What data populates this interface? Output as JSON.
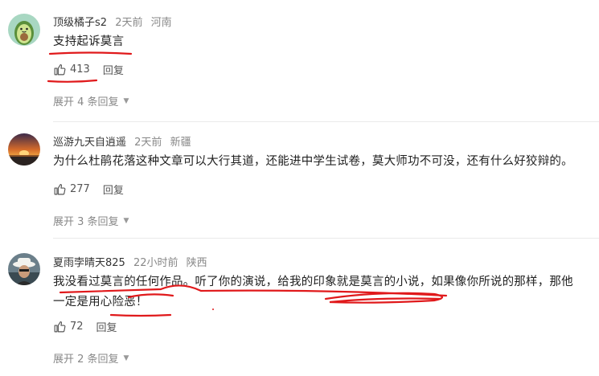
{
  "comments": [
    {
      "username": "顶级橘子s2",
      "time": "2天前",
      "location": "河南",
      "text": "支持起诉莫言",
      "likes": "413",
      "reply_label": "回复",
      "expand_label": "展开 4 条回复",
      "avatar_icon": "avocado-avatar-icon"
    },
    {
      "username": "巡游九天自逍遥",
      "time": "2天前",
      "location": "新疆",
      "text": "为什么杜鹃花落这种文章可以大行其道，还能进中学生试卷，莫大师功不可没，还有什么好狡辩的。",
      "likes": "277",
      "reply_label": "回复",
      "expand_label": "展开 3 条回复",
      "avatar_icon": "sunset-avatar-icon"
    },
    {
      "username": "夏雨孛晴天825",
      "time": "22小时前",
      "location": "陕西",
      "text_line1": "我没看过莫言的任何作品。听了你的演说，给我的印象就是莫言的小说，如果像你所说的那样，那他",
      "text_line2": "一定是用心险恶！",
      "likes": "72",
      "reply_label": "回复",
      "expand_label": "展开 2 条回复",
      "avatar_icon": "man-with-hat-avatar-icon"
    }
  ],
  "colors": {
    "annotation_red": "#e0191b",
    "text": "#222222",
    "muted": "#888888"
  }
}
